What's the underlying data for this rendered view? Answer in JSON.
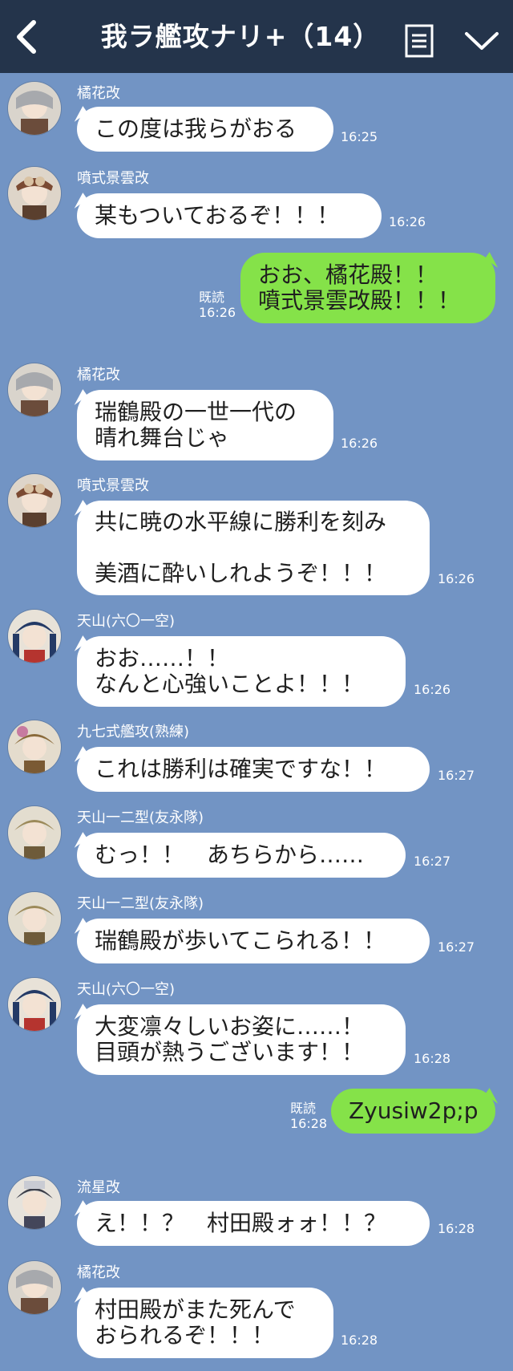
{
  "header": {
    "title": "我ラ艦攻ナリ+（14）",
    "back_icon": "chevron-left-icon",
    "menu_icon": "list-icon",
    "expand_icon": "chevron-down-icon",
    "bg_color": "#24344b"
  },
  "chat_bg": "#7294c4",
  "outgoing_color": "#85e249",
  "messages": [
    {
      "sender": "橘花改",
      "text": "この度は我らがおる",
      "time": "16:25"
    },
    {
      "sender": "噴式景雲改",
      "text": "某もついておるぞ！！！",
      "time": "16:26"
    },
    {
      "read": "既読",
      "text": "おお、橘花殿！！\n噴式景雲改殿！！！",
      "time": "16:26"
    },
    {
      "sender": "橘花改",
      "text": "瑞鶴殿の一世一代の\n晴れ舞台じゃ",
      "time": "16:26"
    },
    {
      "sender": "噴式景雲改",
      "text": "共に暁の水平線に勝利を刻み\n\n美酒に酔いしれようぞ！！！",
      "time": "16:26"
    },
    {
      "sender": "天山(六〇一空)",
      "text": "おお……！！\nなんと心強いことよ！！！",
      "time": "16:26"
    },
    {
      "sender": "九七式艦攻(熟練)",
      "text": "これは勝利は確実ですな！！",
      "time": "16:27"
    },
    {
      "sender": "天山一二型(友永隊)",
      "text": "むっ！！　あちらから……",
      "time": "16:27"
    },
    {
      "sender": "天山一二型(友永隊)",
      "text": "瑞鶴殿が歩いてこられる！！",
      "time": "16:27"
    },
    {
      "sender": "天山(六〇一空)",
      "text": "大変凛々しいお姿に……！\n目頭が熱うございます！！",
      "time": "16:28"
    },
    {
      "read": "既読",
      "text": "Zyusiw2p;p",
      "time": "16:28"
    },
    {
      "sender": "流星改",
      "text": "え！！？　村田殿ォォ！！？",
      "time": "16:28"
    },
    {
      "sender": "橘花改",
      "text": "村田殿がまた死んで\nおられるぞ！！！",
      "time": "16:28"
    }
  ]
}
